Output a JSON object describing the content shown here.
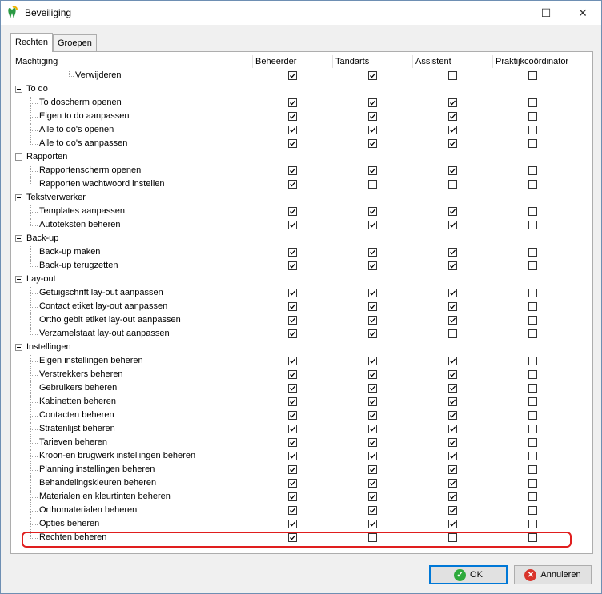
{
  "window": {
    "title": "Beveiliging",
    "controls": {
      "minimize": "—",
      "maximize": "☐",
      "close": "✕"
    }
  },
  "tabs": [
    {
      "label": "Rechten",
      "active": true
    },
    {
      "label": "Groepen",
      "active": false
    }
  ],
  "columns": [
    "Machtiging",
    "Beheerder",
    "Tandarts",
    "Assistent",
    "Praktijkcoördinator"
  ],
  "rows": [
    {
      "label": "Verwijderen",
      "level": 2,
      "checks": [
        true,
        true,
        false,
        false
      ]
    },
    {
      "label": "To do",
      "level": 0
    },
    {
      "label": "To doscherm openen",
      "level": 1,
      "checks": [
        true,
        true,
        true,
        false
      ]
    },
    {
      "label": "Eigen to do aanpassen",
      "level": 1,
      "checks": [
        true,
        true,
        true,
        false
      ]
    },
    {
      "label": "Alle to do's openen",
      "level": 1,
      "checks": [
        true,
        true,
        true,
        false
      ]
    },
    {
      "label": "Alle to do's aanpassen",
      "level": 1,
      "checks": [
        true,
        true,
        true,
        false
      ]
    },
    {
      "label": "Rapporten",
      "level": 0
    },
    {
      "label": "Rapportenscherm openen",
      "level": 1,
      "checks": [
        true,
        true,
        true,
        false
      ]
    },
    {
      "label": "Rapporten wachtwoord instellen",
      "level": 1,
      "checks": [
        true,
        false,
        false,
        false
      ]
    },
    {
      "label": "Tekstverwerker",
      "level": 0
    },
    {
      "label": "Templates aanpassen",
      "level": 1,
      "checks": [
        true,
        true,
        true,
        false
      ]
    },
    {
      "label": "Autoteksten beheren",
      "level": 1,
      "checks": [
        true,
        true,
        true,
        false
      ]
    },
    {
      "label": "Back-up",
      "level": 0
    },
    {
      "label": "Back-up maken",
      "level": 1,
      "checks": [
        true,
        true,
        true,
        false
      ]
    },
    {
      "label": "Back-up terugzetten",
      "level": 1,
      "checks": [
        true,
        true,
        true,
        false
      ]
    },
    {
      "label": "Lay-out",
      "level": 0
    },
    {
      "label": "Getuigschrift lay-out aanpassen",
      "level": 1,
      "checks": [
        true,
        true,
        true,
        false
      ]
    },
    {
      "label": "Contact etiket lay-out aanpassen",
      "level": 1,
      "checks": [
        true,
        true,
        true,
        false
      ]
    },
    {
      "label": "Ortho gebit etiket lay-out aanpassen",
      "level": 1,
      "checks": [
        true,
        true,
        true,
        false
      ]
    },
    {
      "label": "Verzamelstaat lay-out aanpassen",
      "level": 1,
      "checks": [
        true,
        true,
        false,
        false
      ]
    },
    {
      "label": "Instellingen",
      "level": 0
    },
    {
      "label": "Eigen instellingen beheren",
      "level": 1,
      "checks": [
        true,
        true,
        true,
        false
      ]
    },
    {
      "label": "Verstrekkers beheren",
      "level": 1,
      "checks": [
        true,
        true,
        true,
        false
      ]
    },
    {
      "label": "Gebruikers beheren",
      "level": 1,
      "checks": [
        true,
        true,
        true,
        false
      ]
    },
    {
      "label": "Kabinetten beheren",
      "level": 1,
      "checks": [
        true,
        true,
        true,
        false
      ]
    },
    {
      "label": "Contacten beheren",
      "level": 1,
      "checks": [
        true,
        true,
        true,
        false
      ]
    },
    {
      "label": "Stratenlijst beheren",
      "level": 1,
      "checks": [
        true,
        true,
        true,
        false
      ]
    },
    {
      "label": "Tarieven beheren",
      "level": 1,
      "checks": [
        true,
        true,
        true,
        false
      ]
    },
    {
      "label": "Kroon-en brugwerk instellingen beheren",
      "level": 1,
      "checks": [
        true,
        true,
        true,
        false
      ]
    },
    {
      "label": "Planning instellingen beheren",
      "level": 1,
      "checks": [
        true,
        true,
        true,
        false
      ]
    },
    {
      "label": "Behandelingskleuren beheren",
      "level": 1,
      "checks": [
        true,
        true,
        true,
        false
      ]
    },
    {
      "label": "Materialen en kleurtinten beheren",
      "level": 1,
      "checks": [
        true,
        true,
        true,
        false
      ]
    },
    {
      "label": "Orthomaterialen beheren",
      "level": 1,
      "checks": [
        true,
        true,
        true,
        false
      ]
    },
    {
      "label": "Opties beheren",
      "level": 1,
      "checks": [
        true,
        true,
        true,
        false
      ]
    },
    {
      "label": "Rechten beheren",
      "level": 1,
      "checks": [
        true,
        false,
        false,
        false
      ],
      "highlighted": true
    }
  ],
  "buttons": {
    "ok": "OK",
    "cancel": "Annuleren"
  },
  "colors": {
    "highlight": "#e01e1e",
    "ok_icon": "#2eaa3c",
    "cancel_icon": "#d9342b",
    "focus": "#0078d7"
  }
}
